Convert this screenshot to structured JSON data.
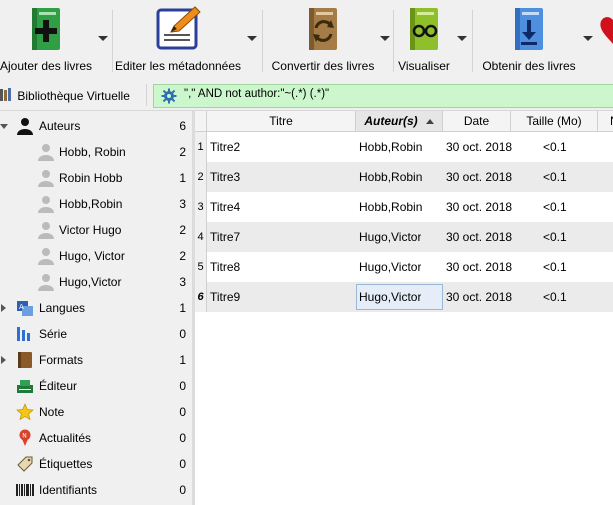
{
  "toolbar": {
    "buttons": [
      {
        "label": "Ajouter des livres",
        "icon": "add-books-icon"
      },
      {
        "label": "Editer les métadonnées",
        "icon": "edit-metadata-icon"
      },
      {
        "label": "Convertir des livres",
        "icon": "convert-books-icon"
      },
      {
        "label": "Visualiser",
        "icon": "view-book-icon"
      },
      {
        "label": "Obtenir des livres",
        "icon": "get-books-icon"
      }
    ]
  },
  "virtual_library": {
    "label": "Bibliothèque Virtuelle"
  },
  "search": {
    "query": "\",\" AND not author:\"~(.*) (.*)\""
  },
  "tree": {
    "authors": {
      "label": "Auteurs",
      "count": "6",
      "children": [
        {
          "label": "Hobb, Robin",
          "count": "2"
        },
        {
          "label": "Robin Hobb",
          "count": "1"
        },
        {
          "label": "Hobb,Robin",
          "count": "3"
        },
        {
          "label": "Victor Hugo",
          "count": "2"
        },
        {
          "label": "Hugo, Victor",
          "count": "2"
        },
        {
          "label": "Hugo,Victor",
          "count": "3"
        }
      ]
    },
    "categories": [
      {
        "label": "Langues",
        "count": "1"
      },
      {
        "label": "Série",
        "count": "0"
      },
      {
        "label": "Formats",
        "count": "1"
      },
      {
        "label": "Éditeur",
        "count": "0"
      },
      {
        "label": "Note",
        "count": "0"
      },
      {
        "label": "Actualités",
        "count": "0"
      },
      {
        "label": "Étiquettes",
        "count": "0"
      },
      {
        "label": "Identifiants",
        "count": "0"
      }
    ]
  },
  "table": {
    "columns": [
      "Titre",
      "Auteur(s)",
      "Date",
      "Taille (Mo)",
      "N"
    ],
    "rows": [
      {
        "num": "1",
        "title": "Titre2",
        "author": "Hobb,Robin",
        "date": "30 oct. 2018",
        "size": "<0.1"
      },
      {
        "num": "2",
        "title": "Titre3",
        "author": "Hobb,Robin",
        "date": "30 oct. 2018",
        "size": "<0.1"
      },
      {
        "num": "3",
        "title": "Titre4",
        "author": "Hobb,Robin",
        "date": "30 oct. 2018",
        "size": "<0.1"
      },
      {
        "num": "4",
        "title": "Titre7",
        "author": "Hugo,Victor",
        "date": "30 oct. 2018",
        "size": "<0.1"
      },
      {
        "num": "5",
        "title": "Titre8",
        "author": "Hugo,Victor",
        "date": "30 oct. 2018",
        "size": "<0.1"
      },
      {
        "num": "6",
        "title": "Titre9",
        "author": "Hugo,Victor",
        "date": "30 oct. 2018",
        "size": "<0.1"
      }
    ]
  }
}
